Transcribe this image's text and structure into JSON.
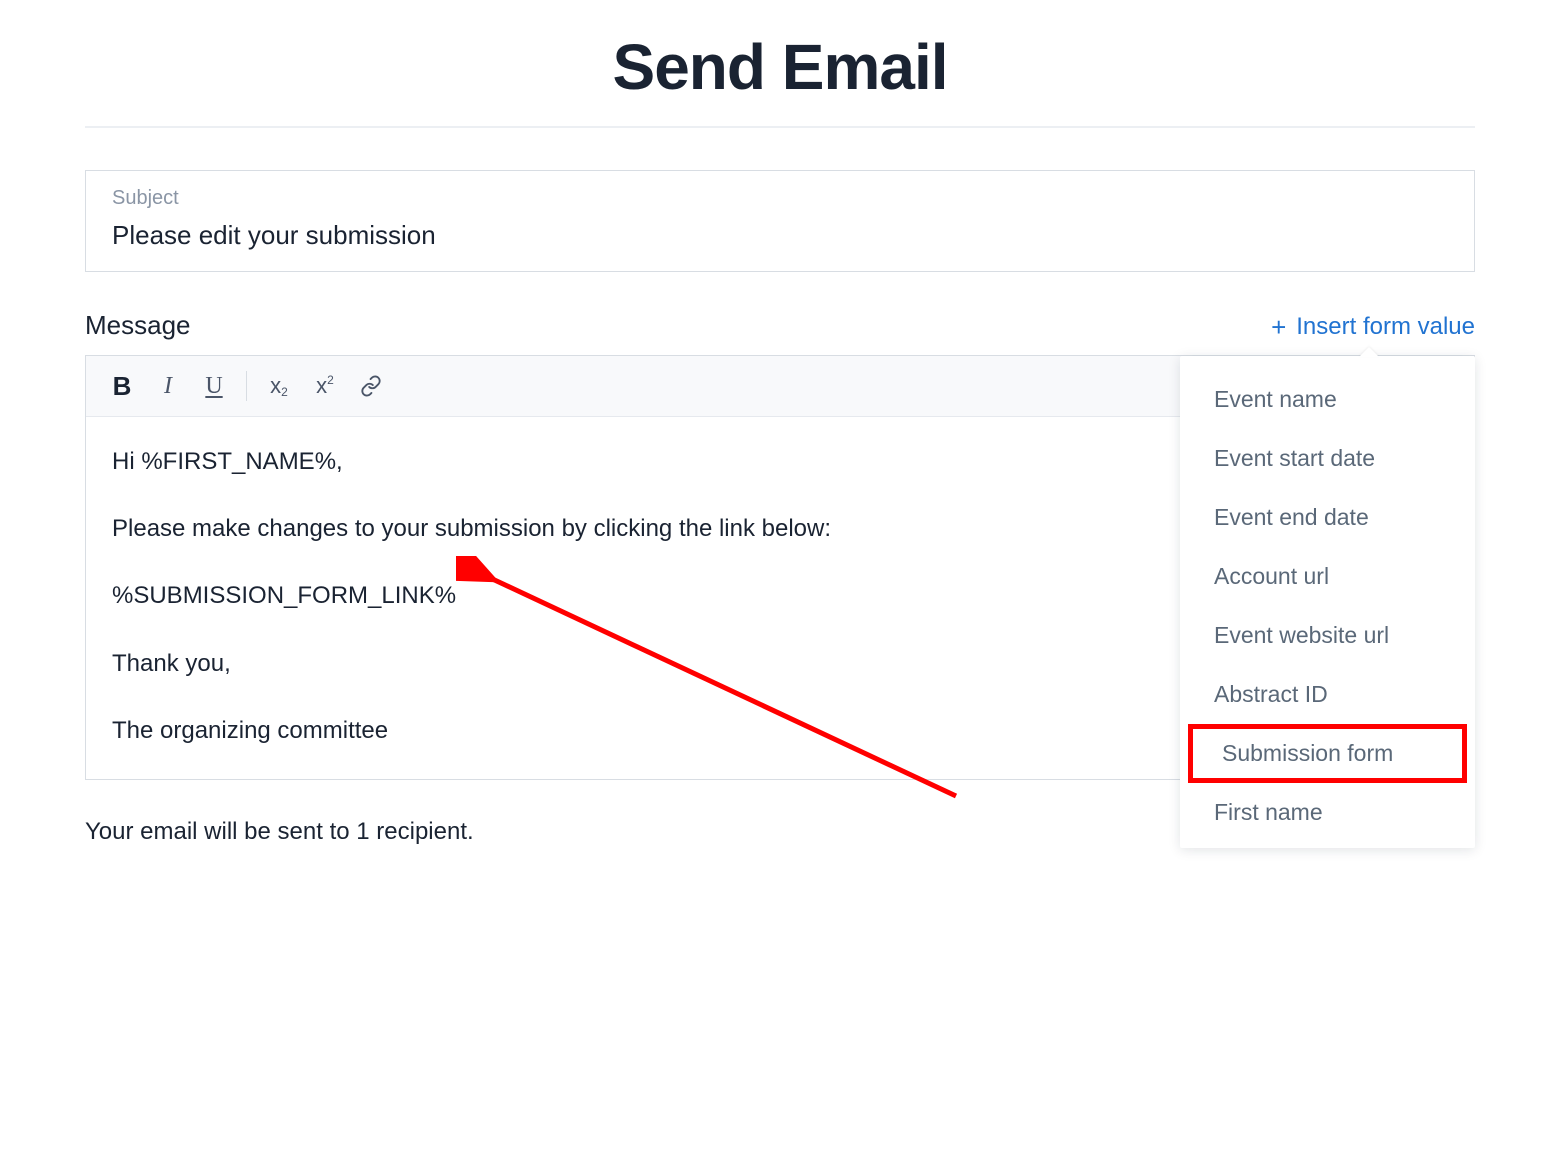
{
  "title": "Send Email",
  "subject": {
    "label": "Subject",
    "value": "Please edit your submission"
  },
  "message_label": "Message",
  "insert_link": {
    "plus": "+",
    "label": "Insert form value"
  },
  "toolbar": {
    "bold": "B",
    "italic": "I",
    "underline": "U",
    "subscript_x": "x",
    "subscript_2": "2",
    "superscript_x": "x",
    "superscript_2": "2"
  },
  "body": {
    "p1": "Hi %FIRST_NAME%,",
    "p2": "Please make changes to your submission by clicking the link below:",
    "p3": "%SUBMISSION_FORM_LINK%",
    "p4": "Thank you,",
    "p5": "The organizing committee"
  },
  "recipient_note": "Your email will be sent to 1 recipient.",
  "dropdown": {
    "items": [
      "Event name",
      "Event start date",
      "Event end date",
      "Account url",
      "Event website url",
      "Abstract ID",
      "Submission form",
      "First name"
    ],
    "highlighted_index": 6
  },
  "annotation": {
    "highlight_color": "#ff0000"
  }
}
